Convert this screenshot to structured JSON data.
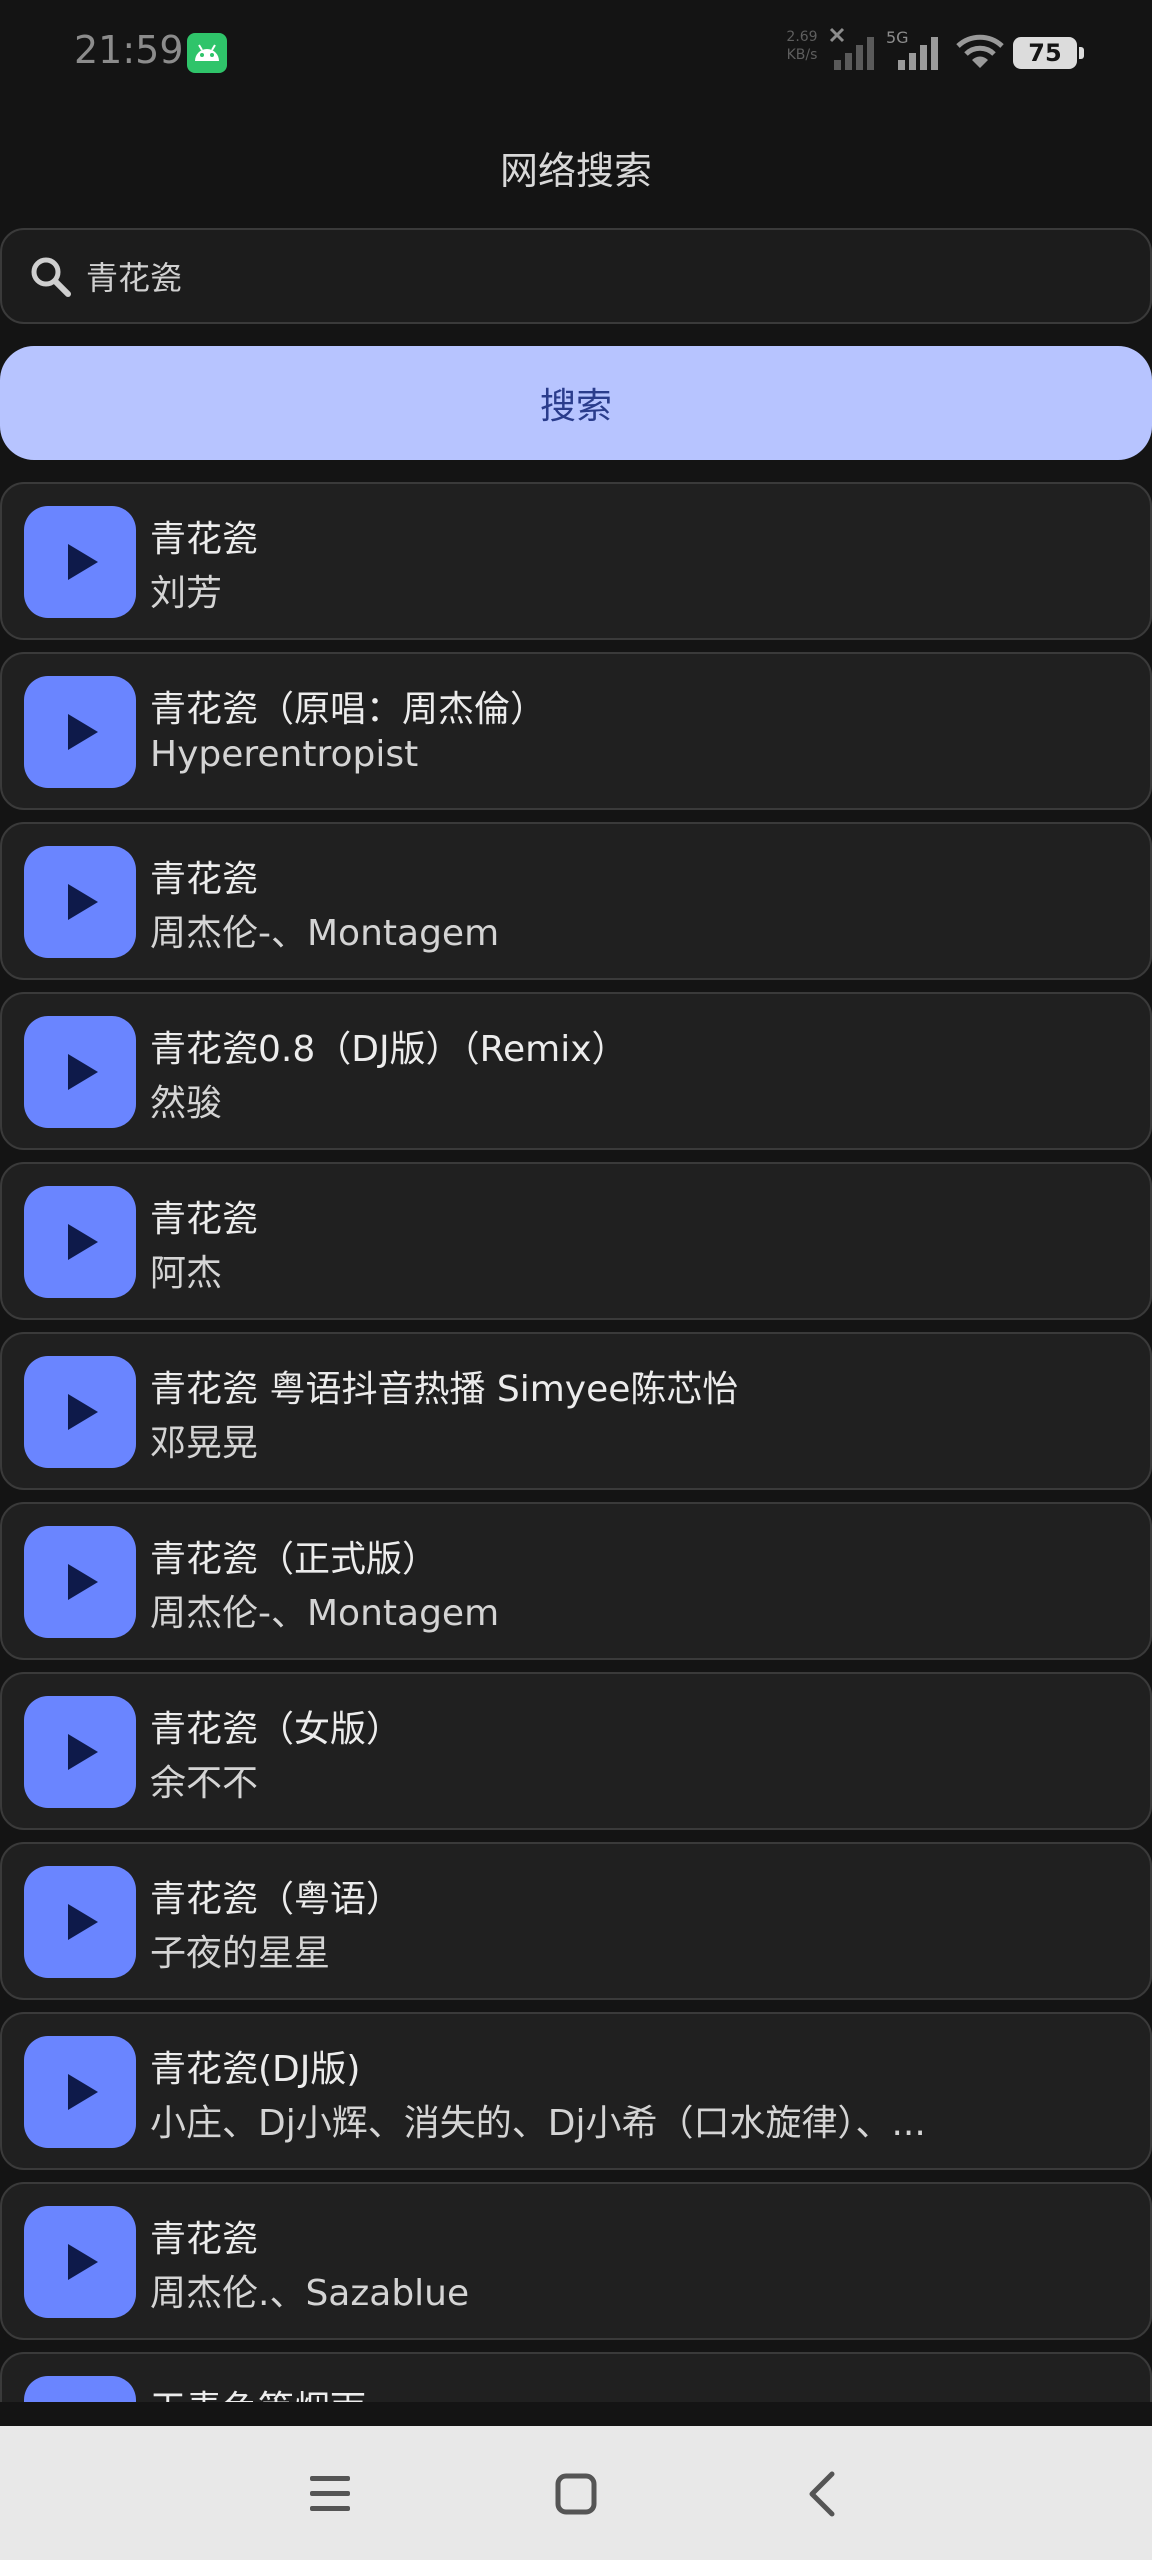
{
  "status_bar": {
    "time": "21:59",
    "net_speed_value": "2.69",
    "net_speed_unit": "KB/s",
    "network_type": "5G",
    "battery": "75"
  },
  "page_title": "网络搜索",
  "search": {
    "query": "青花瓷",
    "button_label": "搜索"
  },
  "results": [
    {
      "title": "青花瓷",
      "artist": "刘芳"
    },
    {
      "title": "青花瓷（原唱：周杰倫）",
      "artist": "Hyperentropist"
    },
    {
      "title": "青花瓷",
      "artist": "周杰伦-、Montagem"
    },
    {
      "title": "青花瓷0.8（DJ版）（Remix）",
      "artist": "然骏"
    },
    {
      "title": "青花瓷",
      "artist": "阿杰"
    },
    {
      "title": "青花瓷 粤语抖音热播 Simyee陈芯怡",
      "artist": "邓晃晃"
    },
    {
      "title": "青花瓷（正式版）",
      "artist": "周杰伦-、Montagem"
    },
    {
      "title": "青花瓷（女版）",
      "artist": "余不不"
    },
    {
      "title": "青花瓷（粤语）",
      "artist": "子夜的星星"
    },
    {
      "title": "青花瓷(DJ版)",
      "artist": "小庄、Dj小辉、消失的、Dj小希（口水旋律）、..."
    },
    {
      "title": "青花瓷",
      "artist": "周杰伦.、Sazablue"
    },
    {
      "title": "天青色等烟雨",
      "artist": ""
    }
  ],
  "colors": {
    "background": "#141414",
    "card": "#202020",
    "accent_button": "#b7c4ff",
    "play_button": "#6a85ff"
  },
  "icons": {
    "search": "search-icon",
    "play": "play-icon",
    "nav_menu": "menu-icon",
    "nav_home": "home-icon",
    "nav_back": "back-icon"
  }
}
